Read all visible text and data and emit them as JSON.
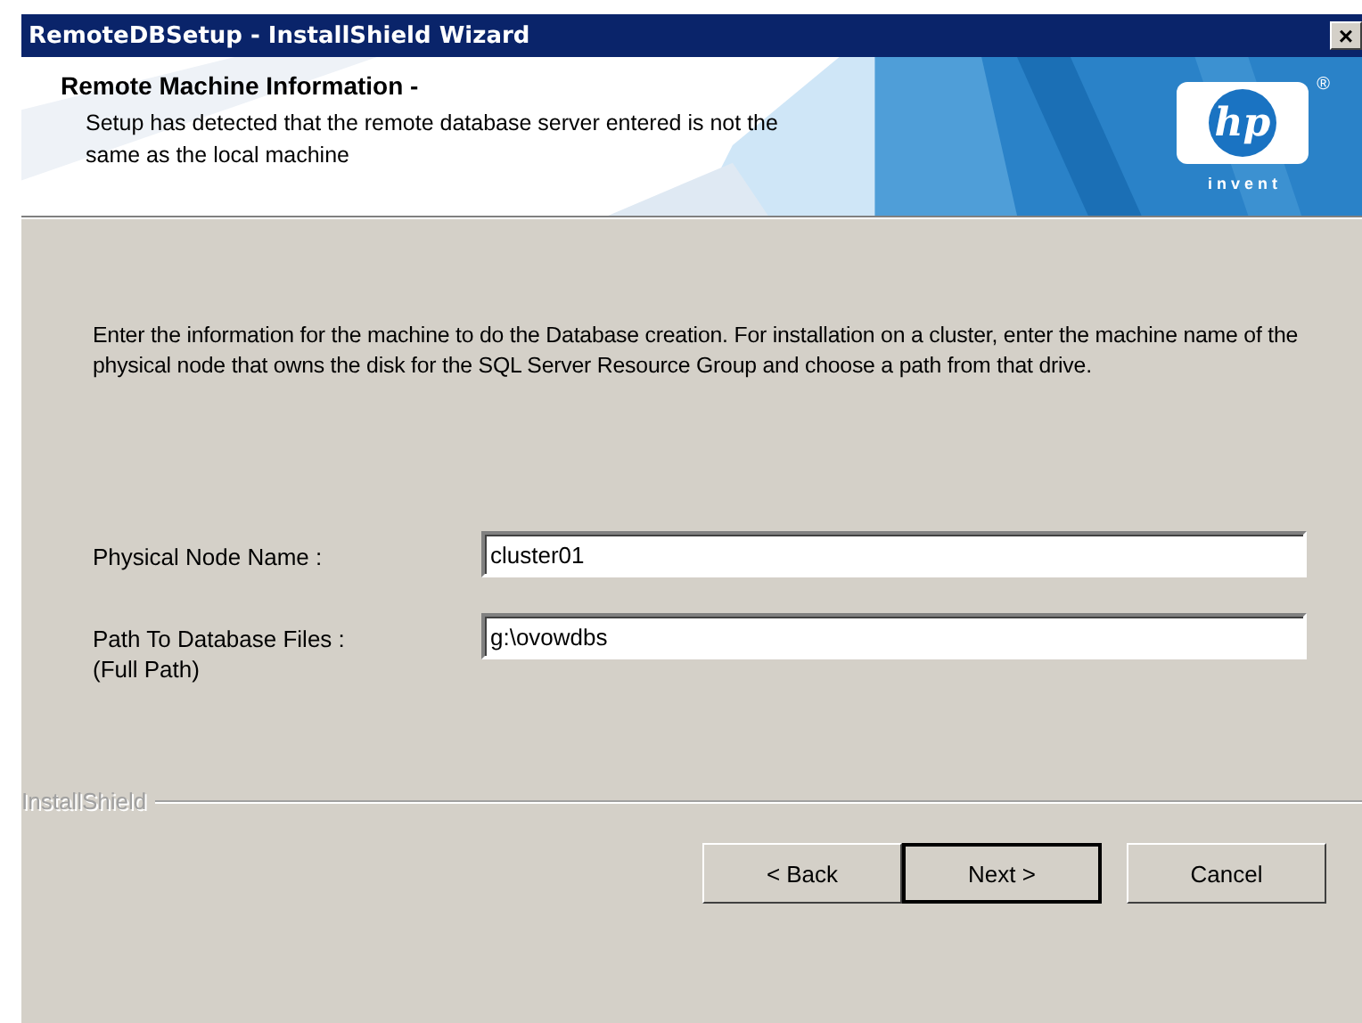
{
  "window": {
    "title": "RemoteDBSetup - InstallShield Wizard",
    "close": "×"
  },
  "header": {
    "title": "Remote Machine Information -",
    "subtitle": "Setup has detected that the remote database server entered is not the same as the local machine",
    "logo": {
      "mark": "hp",
      "registered": "®",
      "tagline": "i n v e n t"
    }
  },
  "instructions": "Enter the information for the machine to do the Database creation.  For installation on a cluster, enter the machine name of the physical node that owns the disk for the SQL Server Resource Group and choose a path from that drive.",
  "fields": [
    {
      "label": "Physical Node Name :",
      "value": "cluster01"
    },
    {
      "label": "Path To Database Files :",
      "note": "(Full Path)",
      "value": "g:\\ovowdbs"
    }
  ],
  "brand": "InstallShield",
  "buttons": [
    {
      "label": "< Back",
      "default": false
    },
    {
      "label": "Next >",
      "default": true
    },
    {
      "label": "Cancel",
      "default": false
    }
  ]
}
